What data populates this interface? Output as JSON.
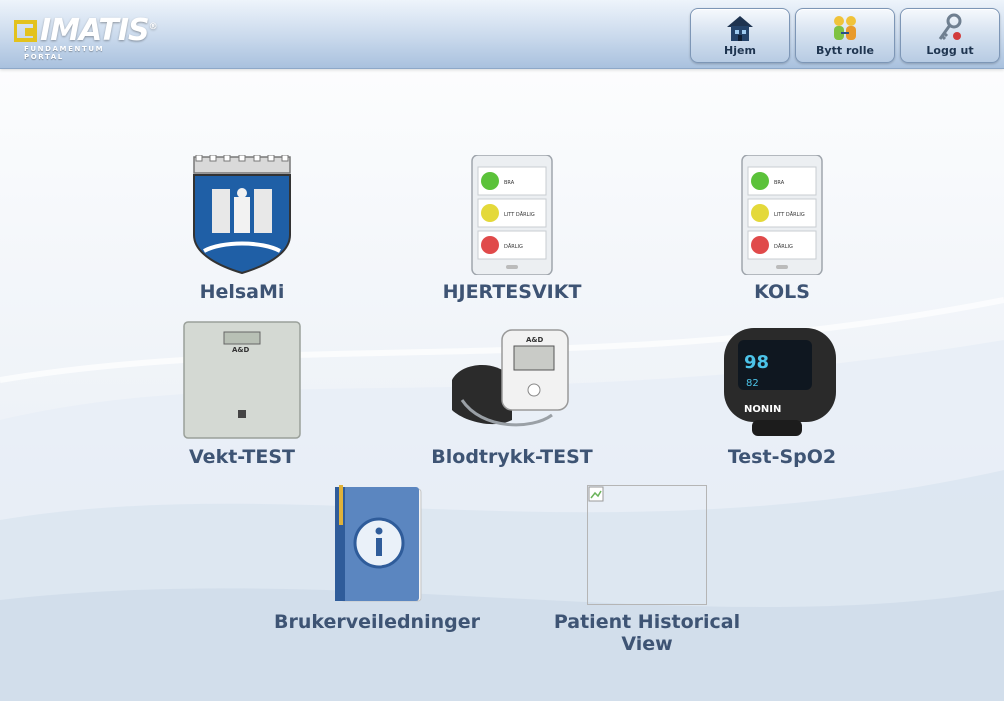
{
  "header": {
    "logo_text": "IMATIS",
    "logo_sub": "FUNDAMENTUM PORTAL",
    "buttons": [
      {
        "label": "Hjem",
        "icon": "home-icon"
      },
      {
        "label": "Bytt rolle",
        "icon": "switch-role-icon"
      },
      {
        "label": "Logg ut",
        "icon": "logout-key-icon"
      }
    ]
  },
  "apps": [
    {
      "label": "HelsaMi",
      "icon": "coat-of-arms-icon"
    },
    {
      "label": "HJERTESVIKT",
      "icon": "tablet-smiley-icon"
    },
    {
      "label": "KOLS",
      "icon": "tablet-smiley-icon"
    },
    {
      "label": "Vekt-TEST",
      "icon": "scale-icon"
    },
    {
      "label": "Blodtrykk-TEST",
      "icon": "blood-pressure-monitor-icon"
    },
    {
      "label": "Test-SpO2",
      "icon": "pulse-oximeter-icon"
    },
    {
      "label": "Brukerveiledninger",
      "icon": "info-book-icon"
    },
    {
      "label": "Patient Historical View",
      "icon": "broken-image-icon"
    }
  ],
  "tablet_rows": [
    "BRA",
    "LITT DÅRLIG",
    "DÅRLIG"
  ],
  "device_text": {
    "scale_brand": "A&D",
    "bp_brand": "A&D",
    "oximeter_value1": "98",
    "oximeter_value2": "82",
    "oximeter_brand": "NONIN"
  },
  "colors": {
    "label": "#3e5474",
    "header_top": "#eef4fb",
    "header_bottom": "#a9c1de"
  }
}
